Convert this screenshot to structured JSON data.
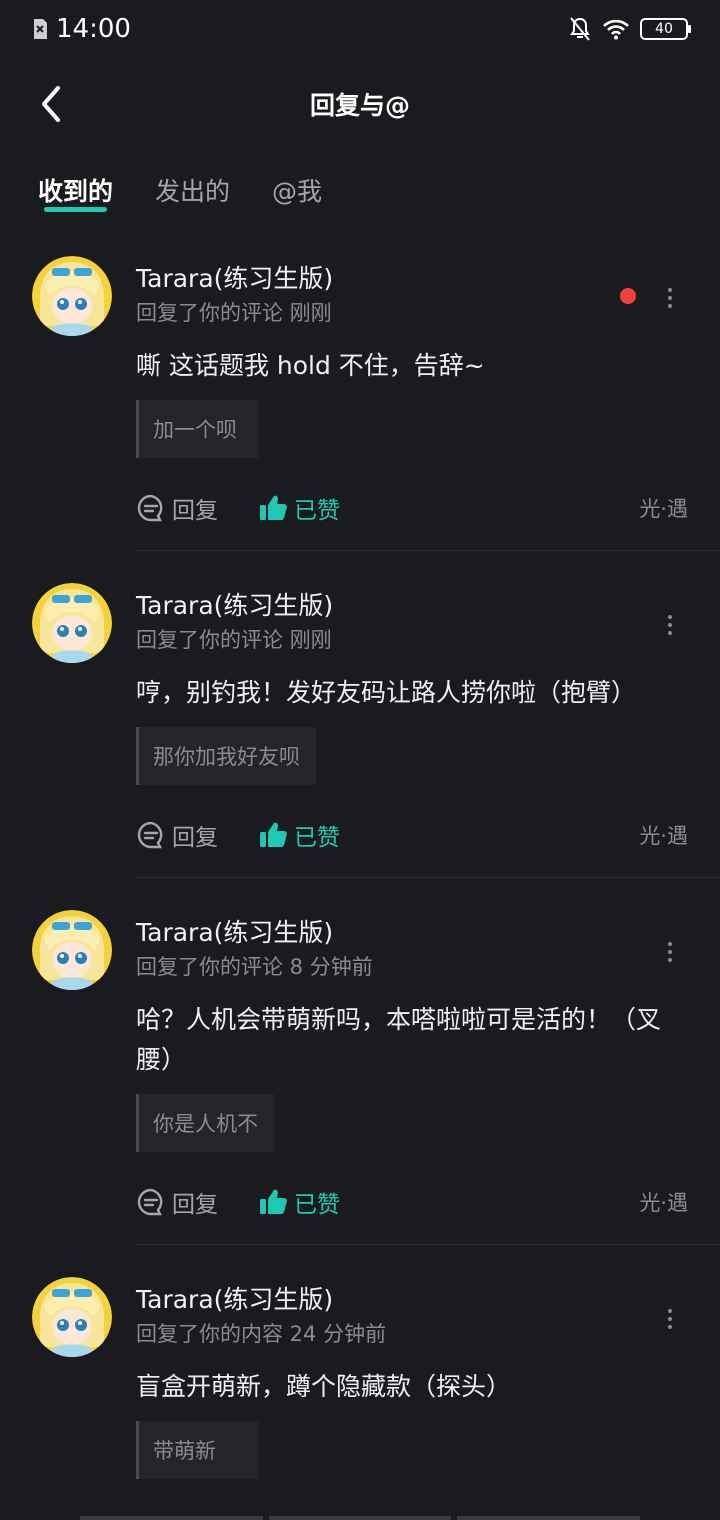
{
  "status_bar": {
    "time": "14:00",
    "battery": "40"
  },
  "nav": {
    "title": "回复与@"
  },
  "tabs": [
    {
      "label": "收到的",
      "active": true
    },
    {
      "label": "发出的",
      "active": false
    },
    {
      "label": "@我",
      "active": false
    }
  ],
  "items": [
    {
      "name": "Tarara(练习生版)",
      "meta": "回复了你的评论 刚刚",
      "body": "嘶 这话题我 hold 不住，告辞~",
      "quote": "加一个呗",
      "reply_label": "回复",
      "liked_label": "已赞",
      "source": "光·遇",
      "unread": true
    },
    {
      "name": "Tarara(练习生版)",
      "meta": "回复了你的评论 刚刚",
      "body": "哼，别钓我！发好友码让路人捞你啦（抱臂）",
      "quote": "那你加我好友呗",
      "reply_label": "回复",
      "liked_label": "已赞",
      "source": "光·遇",
      "unread": false
    },
    {
      "name": "Tarara(练习生版)",
      "meta": "回复了你的评论 8 分钟前",
      "body": "哈？人机会带萌新吗，本嗒啦啦可是活的！（叉腰）",
      "quote": "你是人机不",
      "reply_label": "回复",
      "liked_label": "已赞",
      "source": "光·遇",
      "unread": false
    },
    {
      "name": "Tarara(练习生版)",
      "meta": "回复了你的内容 24 分钟前",
      "body": "盲盒开萌新，蹲个隐藏款（探头）",
      "quote": "带萌新",
      "reply_label": "回复",
      "liked_label": "已赞",
      "source": "光·遇",
      "unread": false
    }
  ],
  "colors": {
    "accent": "#1ec8b3",
    "unread_dot": "#f0433b",
    "background": "#1a1b1f"
  }
}
